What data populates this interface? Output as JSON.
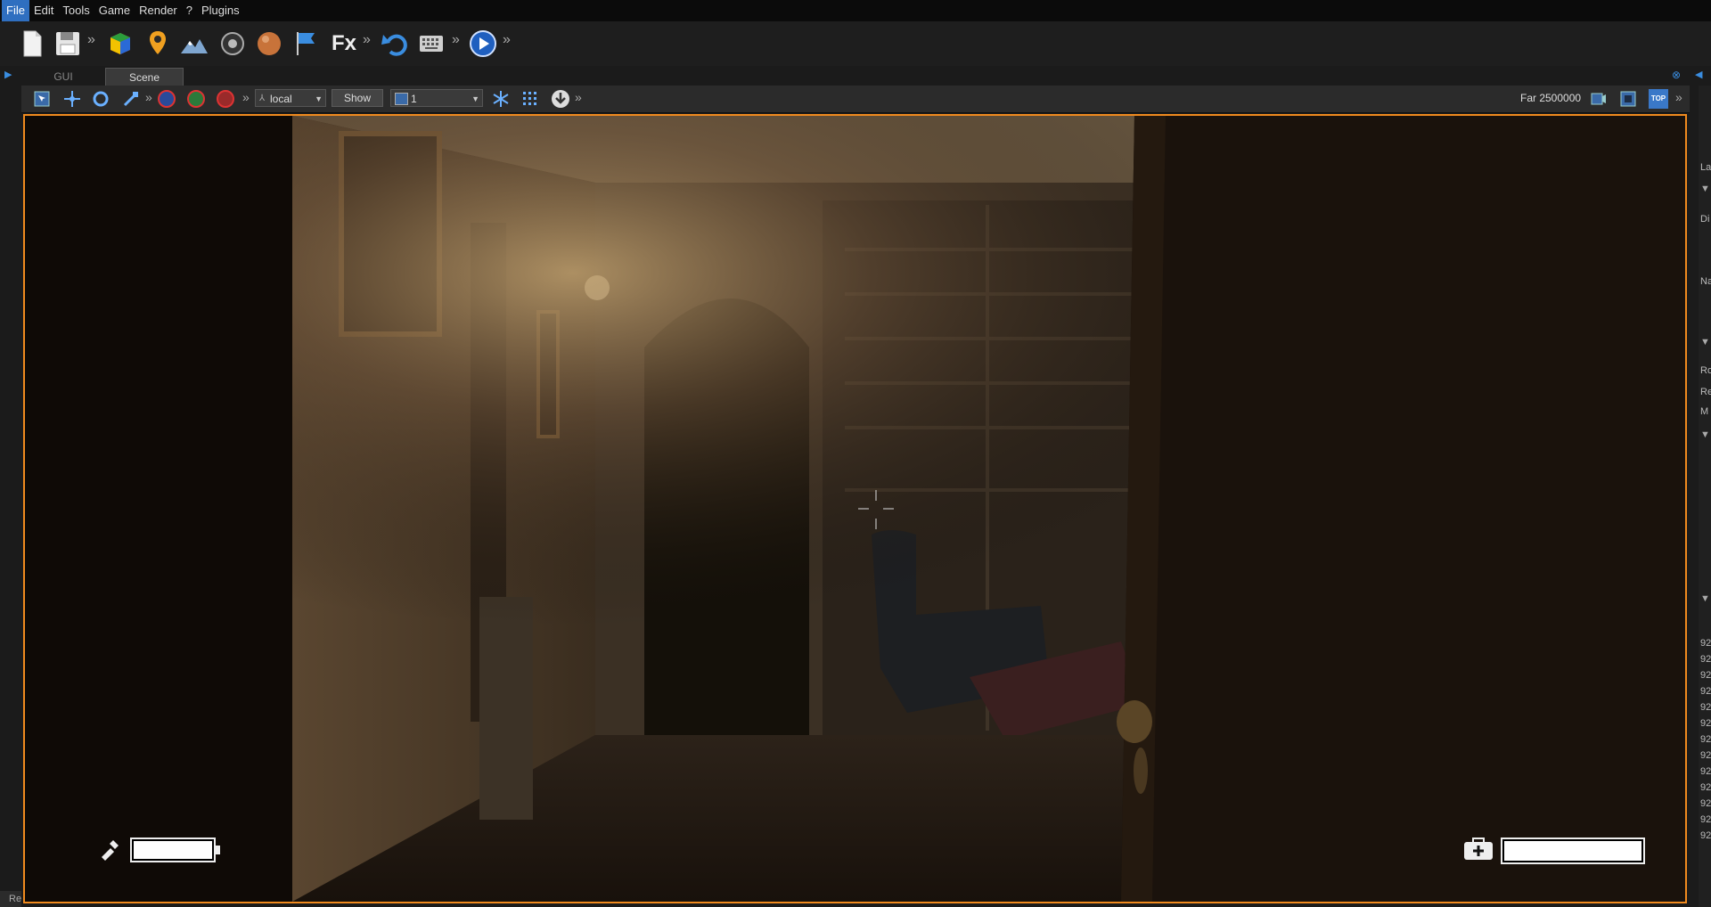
{
  "menu": {
    "items": [
      {
        "label": "File",
        "active": true
      },
      {
        "label": "Edit"
      },
      {
        "label": "Tools"
      },
      {
        "label": "Game"
      },
      {
        "label": "Render"
      },
      {
        "label": "?"
      },
      {
        "label": "Plugins"
      }
    ]
  },
  "toolbar": {
    "fx_label": "Fx",
    "chevron": "»"
  },
  "tabs": [
    {
      "label": "GUI",
      "active": false
    },
    {
      "label": "Scene",
      "active": true
    }
  ],
  "viewport_toolbar": {
    "space_select": "local",
    "show_button": "Show",
    "layer_select": "1",
    "far_label": "Far 2500000",
    "top_view": "TOP",
    "chevron": "»"
  },
  "hud": {
    "flashlight_battery_level": 1.0,
    "health_level": 1.0
  },
  "right_panel": {
    "labels": [
      "La",
      "Di",
      "Na",
      "Ro",
      "Re",
      "M",
      "92",
      "92",
      "92",
      "92",
      "92",
      "92",
      "92",
      "92",
      "92",
      "92",
      "92",
      "92",
      "92"
    ]
  },
  "status": {
    "text": "Re"
  },
  "colors": {
    "accent": "#2f6fc0",
    "viewport_border": "#f08a1e"
  }
}
